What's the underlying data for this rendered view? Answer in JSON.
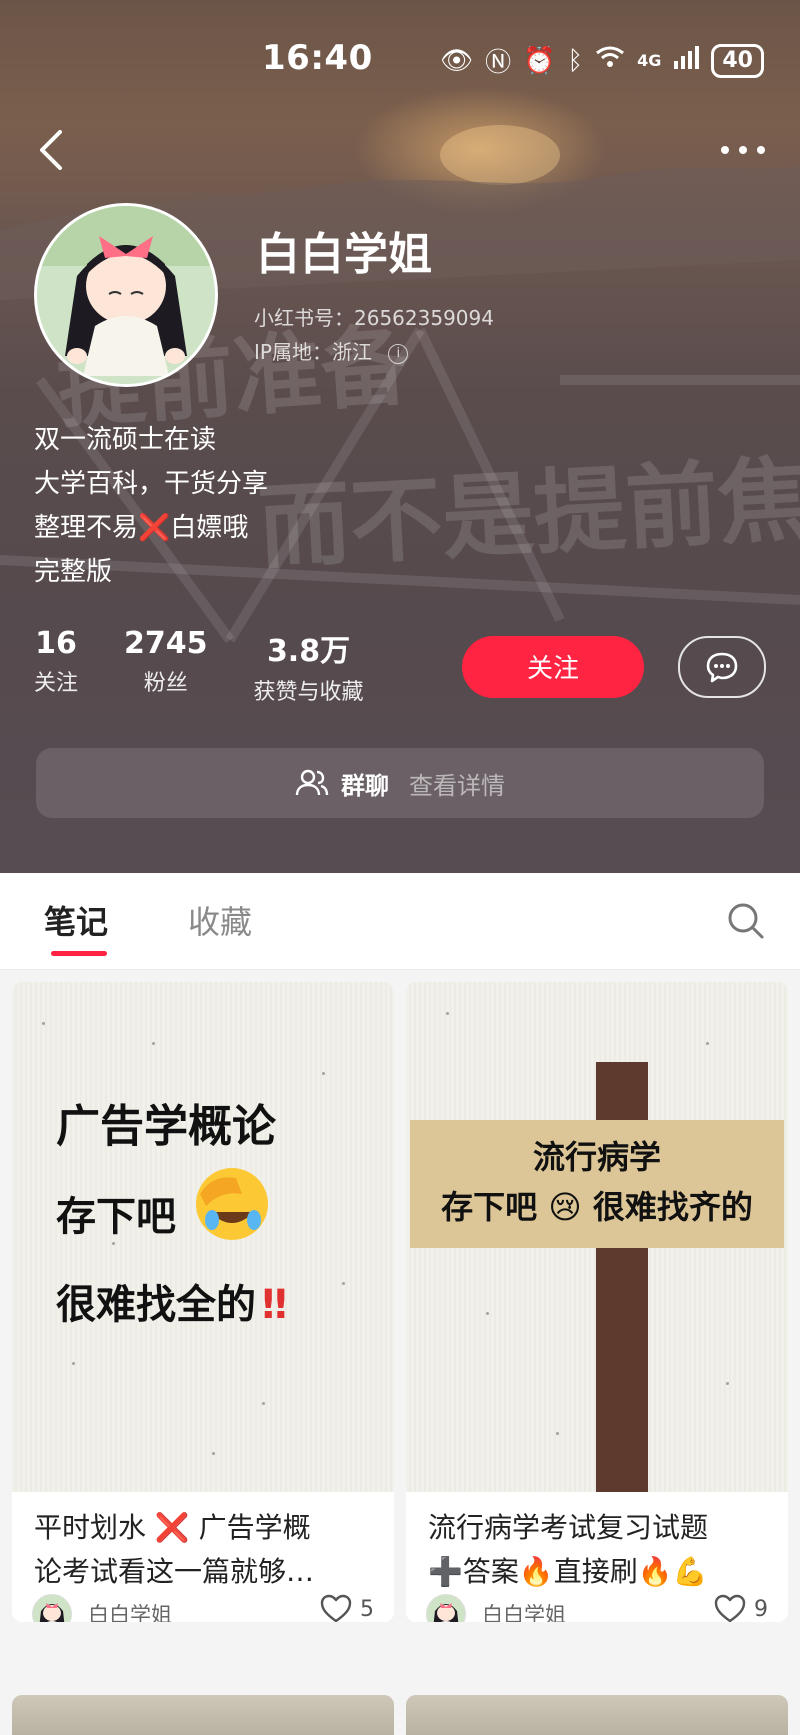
{
  "status_bar": {
    "time": "16:40",
    "network": "4G",
    "battery": "40"
  },
  "profile": {
    "name": "白白学姐",
    "id_label": "小红书号：",
    "id_value": "26562359094",
    "ip_label": "IP属地：",
    "ip_value": "浙江",
    "bio": [
      "双一流硕士在读",
      "大学百科，干货分享",
      "整理不易",
      "白嫖哦",
      "完整版"
    ],
    "stats": [
      {
        "num": "16",
        "label": "关注"
      },
      {
        "num": "2745",
        "label": "粉丝"
      },
      {
        "num": "3.8万",
        "label": "获赞与收藏"
      }
    ],
    "follow_label": "关注",
    "group_title": "群聊",
    "group_link": "查看详情"
  },
  "background_text": [
    "提前准备",
    "而不是提前焦虑"
  ],
  "tabs": {
    "notes": "笔记",
    "favorites": "收藏"
  },
  "notes": [
    {
      "cover_lines": [
        "广告学概论",
        "存下吧",
        "很难找全的"
      ],
      "cover_mark": "‼",
      "title_line1": "平时划水 ❌ 广告学概",
      "title_line2": "论考试看这一篇就够…",
      "author": "白白学姐",
      "likes": "5"
    },
    {
      "cover_lines": [
        "流行病学",
        "存下吧 😢 很难找齐的"
      ],
      "title_line1": "流行病学考试复习试题",
      "title_line2": "➕答案🔥直接刷🔥💪",
      "author": "白白学姐",
      "likes": "9"
    }
  ],
  "colors": {
    "accent": "#ff2442",
    "header_bg": "#574c52"
  }
}
